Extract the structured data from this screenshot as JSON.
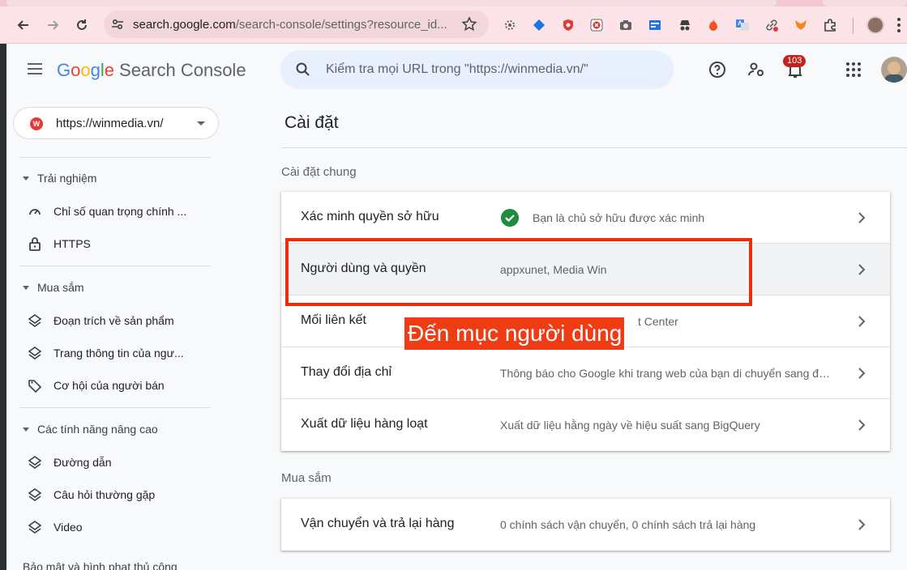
{
  "browser": {
    "url_host": "search.google.com",
    "url_path": "/search-console/settings?resource_id..."
  },
  "app": {
    "logo_letters": [
      "G",
      "o",
      "o",
      "g",
      "l",
      "e"
    ],
    "product_name": "Search Console",
    "search_placeholder": "Kiểm tra mọi URL trong \"https://winmedia.vn/\"",
    "notification_count": "103"
  },
  "sidebar": {
    "property": "https://winmedia.vn/",
    "property_logo": "W",
    "sections": [
      {
        "title": "Trải nghiệm",
        "items": [
          {
            "icon": "speed-gauge-icon",
            "label": "Chỉ số quan trọng chính ..."
          },
          {
            "icon": "lock-icon",
            "label": "HTTPS"
          }
        ]
      },
      {
        "title": "Mua sắm",
        "items": [
          {
            "icon": "layers-icon",
            "label": "Đoạn trích về sản phẩm"
          },
          {
            "icon": "layers-icon",
            "label": "Trang thông tin của ngư..."
          },
          {
            "icon": "tag-icon",
            "label": "Cơ hội của người bán"
          }
        ]
      },
      {
        "title": "Các tính năng nâng cao",
        "items": [
          {
            "icon": "layers-icon",
            "label": "Đường dẫn"
          },
          {
            "icon": "layers-icon",
            "label": "Câu hỏi thường gặp"
          },
          {
            "icon": "layers-icon",
            "label": "Video"
          }
        ]
      }
    ],
    "cut_off_item": "Bảo mật và hình phạt thủ công"
  },
  "main": {
    "title": "Cài đặt",
    "general": {
      "label": "Cài đặt chung",
      "rows": [
        {
          "label": "Xác minh quyền sở hữu",
          "desc": "Bạn là chủ sở hữu được xác minh"
        },
        {
          "label": "Người dùng và quyền",
          "desc": "appxunet, Media Win"
        },
        {
          "label": "Mối liên kết",
          "desc": "t Center"
        },
        {
          "label": "Thay đổi địa chỉ",
          "desc": "Thông báo cho Google khi trang web của bạn di chuyển sang địa..."
        },
        {
          "label": "Xuất dữ liệu hàng loạt",
          "desc": "Xuất dữ liệu hằng ngày về hiệu suất sang BigQuery"
        }
      ]
    },
    "shopping": {
      "label": "Mua sắm",
      "rows": [
        {
          "label": "Vận chuyển và trả lại hàng",
          "desc": "0 chính sách vận chuyển, 0 chính sách trả lại hàng"
        }
      ]
    }
  },
  "annotation": {
    "text": "Đến mục người dùng",
    "color": "#f12a0a"
  }
}
